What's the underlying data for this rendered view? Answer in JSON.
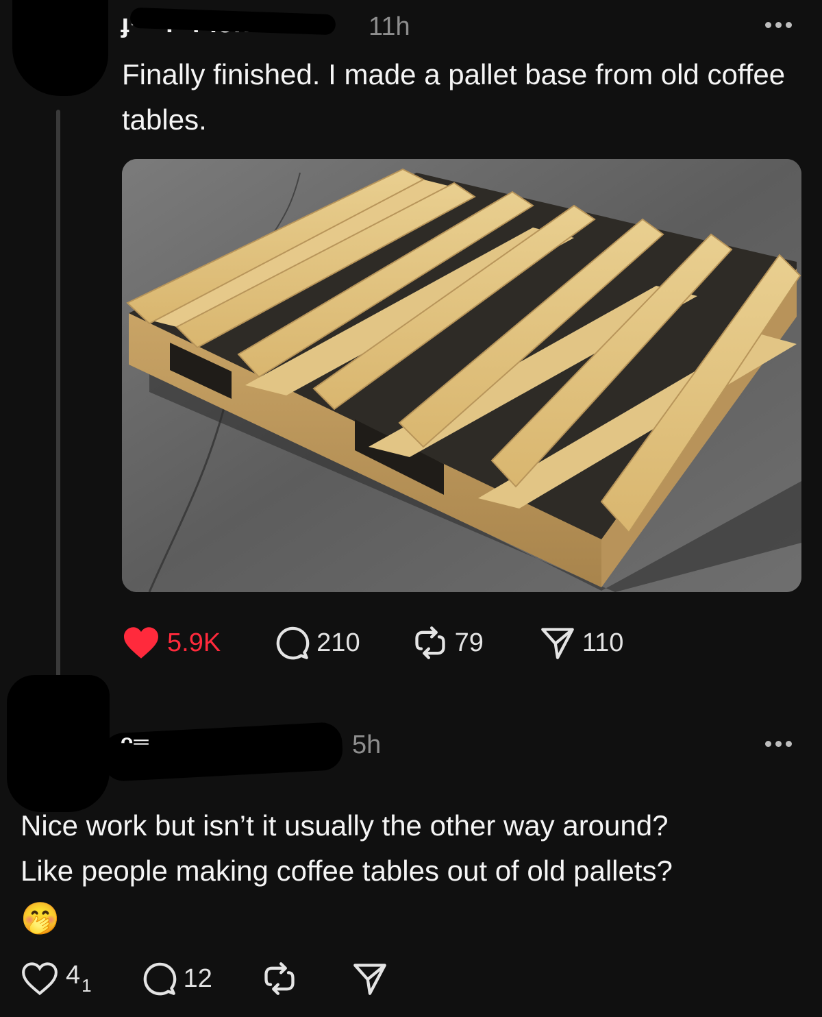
{
  "post": {
    "username_visible": "ɟ·      ··.··.·.c!!",
    "time": "11h",
    "text": "Finally finished. I made a pallet base from old coffee tables.",
    "image_alt": "wooden pallet",
    "stats": {
      "likes": "5.9K",
      "replies": "210",
      "reposts": "79",
      "shares": "110"
    }
  },
  "reply": {
    "username_visible": "ᴖ═",
    "time": "5h",
    "text_line1": "Nice work but isn’t it usually the other way around?",
    "text_line2": "Like people making coffee tables out of old pallets?",
    "emoji": "🤭",
    "stats": {
      "likes": "4",
      "likes_sub": "1",
      "replies": "12"
    }
  },
  "colors": {
    "background": "#101010",
    "like_active": "#ff2a3c",
    "muted": "#8e8e8e"
  },
  "icons": [
    "more-icon",
    "heart-icon",
    "comment-icon",
    "repost-icon",
    "share-icon"
  ]
}
